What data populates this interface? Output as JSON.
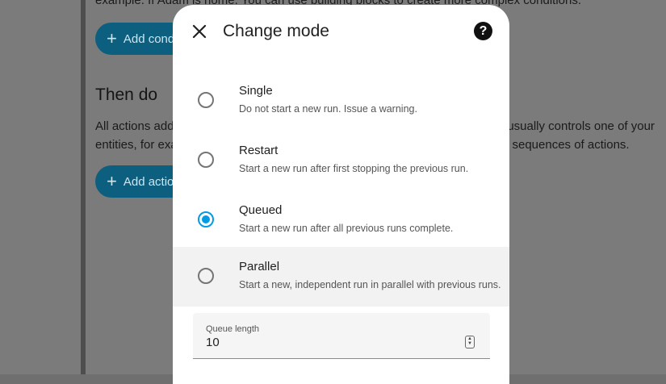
{
  "background": {
    "line_top": "example.  If Adam is home.  You can use building blocks to create more complex conditions.",
    "add_condition_label": "Add condition",
    "then_do_heading": "Then do",
    "actions_line1": "All actions added here will be executed when the automation runs. An action usually controls one of your",
    "actions_line2": "entities, for example, to change an entity's state. You can build more complex sequences of actions.",
    "add_action_label": "Add action"
  },
  "dialog": {
    "title": "Change mode",
    "help_symbol": "?",
    "options": [
      {
        "label": "Single",
        "description": "Do not start a new run. Issue a warning.",
        "checked": false
      },
      {
        "label": "Restart",
        "description": "Start a new run after first stopping the previous run.",
        "checked": false
      },
      {
        "label": "Queued",
        "description": "Start a new run after all previous runs complete.",
        "checked": true
      },
      {
        "label": "Parallel",
        "description": "Start a new, independent run in parallel with previous runs.",
        "checked": false
      }
    ],
    "queue_length": {
      "label": "Queue length",
      "value": "10"
    }
  },
  "colors": {
    "accent": "#039be5",
    "button_bg": "#0c5f7f"
  }
}
